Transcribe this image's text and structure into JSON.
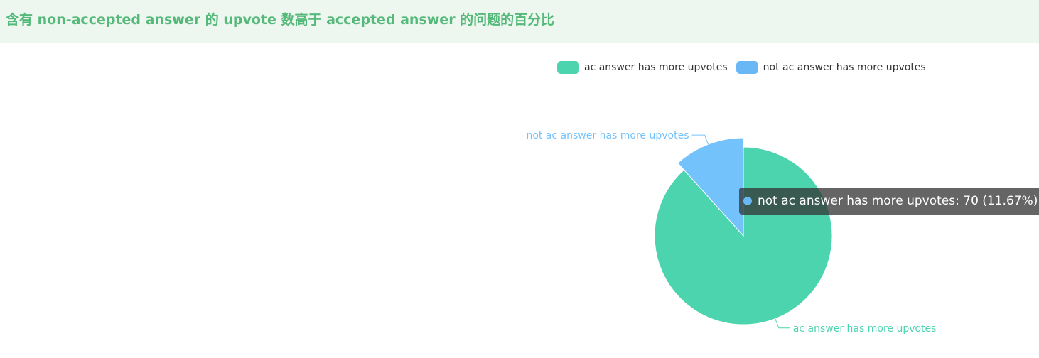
{
  "header": {
    "title": "含有 non-accepted answer 的 upvote 数高于 accepted answer 的问题的百分比"
  },
  "colors": {
    "header_bg": "#edf6ef",
    "title": "#55b97a",
    "series_ac": "#4cd4ae",
    "series_not_ac": "#73c2fc",
    "legend_not_ac": "#6ab7f5"
  },
  "legend": {
    "items": [
      {
        "label": "ac answer has more upvotes"
      },
      {
        "label": "not ac answer has more upvotes"
      }
    ]
  },
  "tooltip": {
    "text": "not ac answer has more upvotes: 70 (11.67%)"
  },
  "chart_data": {
    "type": "pie",
    "title": "含有 non-accepted answer 的 upvote 数高于 accepted answer 的问题的百分比",
    "legend_position": "top-right",
    "slices": [
      {
        "name": "ac answer has more upvotes",
        "value": 530,
        "percent": 88.33
      },
      {
        "name": "not ac answer has more upvotes",
        "value": 70,
        "percent": 11.67
      }
    ]
  }
}
